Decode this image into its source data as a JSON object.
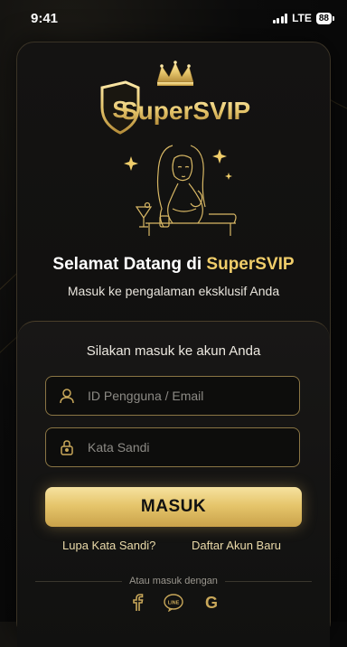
{
  "status_bar": {
    "time": "9:41",
    "network": "LTE",
    "battery": "88"
  },
  "logo": {
    "text_super": "Super",
    "text_svip": "SVIP",
    "shield_letter": "S"
  },
  "welcome": {
    "title_prefix": "Selamat Datang di ",
    "title_brand": "SuperSVIP",
    "subtitle": "Masuk ke pengalaman eksklusif Anda"
  },
  "form": {
    "prompt": "Silakan masuk ke akun Anda",
    "user_placeholder": "ID Pengguna / Email",
    "password_placeholder": "Kata Sandi",
    "login_label": "MASUK",
    "forgot_label": "Lupa Kata Sandi?",
    "register_label": "Daftar Akun Baru",
    "alt_login": "Atau masuk dengan",
    "line_badge": "LINE",
    "google_letter": "G"
  },
  "colors": {
    "gold": "#e6c66c",
    "gold_light": "#f0cd6a",
    "background": "#0b0b0b"
  },
  "icons": [
    "user-icon",
    "lock-icon",
    "facebook-icon",
    "line-icon",
    "google-icon",
    "crown-icon",
    "shield-icon"
  ]
}
